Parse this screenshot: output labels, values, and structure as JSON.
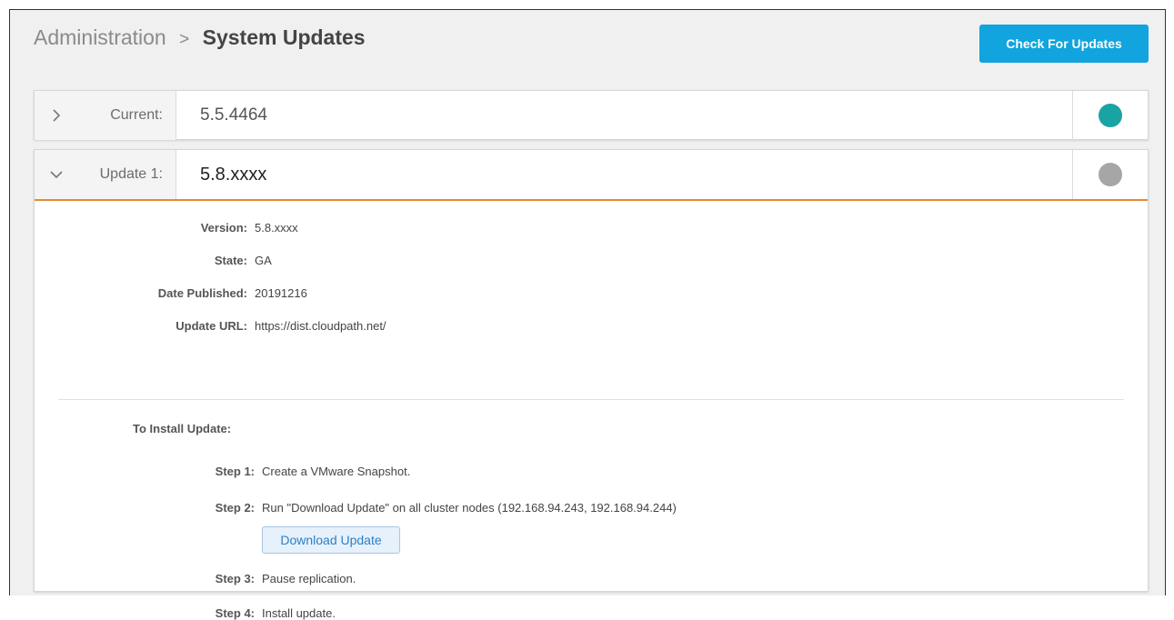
{
  "header": {
    "breadcrumb_parent": "Administration",
    "breadcrumb_separator": ">",
    "breadcrumb_current": "System Updates",
    "check_button_label": "Check For Updates"
  },
  "current": {
    "label": "Current:",
    "value": "5.5.4464",
    "status_color": "#1aa3a3"
  },
  "update": {
    "label": "Update 1:",
    "value": "5.8.xxxx",
    "status_color": "#a6a6a6",
    "details": {
      "version_label": "Version:",
      "version_value": "5.8.xxxx",
      "state_label": "State:",
      "state_value": "GA",
      "date_label": "Date Published:",
      "date_value": "20191216",
      "url_label": "Update URL:",
      "url_value": "https://dist.cloudpath.net/"
    },
    "install": {
      "title": "To Install Update:",
      "steps": [
        {
          "label": "Step 1:",
          "text": "Create a VMware Snapshot."
        },
        {
          "label": "Step 2:",
          "text": "Run \"Download Update\" on all cluster nodes (192.168.94.243, 192.168.94.244)"
        },
        {
          "label": "Step 3:",
          "text": "Pause replication."
        },
        {
          "label": "Step 4:",
          "text": "Install update."
        }
      ],
      "download_button_label": "Download Update"
    }
  },
  "colors": {
    "accent_blue": "#11a4de",
    "expanded_border": "#e88a2d"
  },
  "icons": {
    "collapsed": "chevron-right-icon",
    "expanded": "chevron-down-icon"
  }
}
